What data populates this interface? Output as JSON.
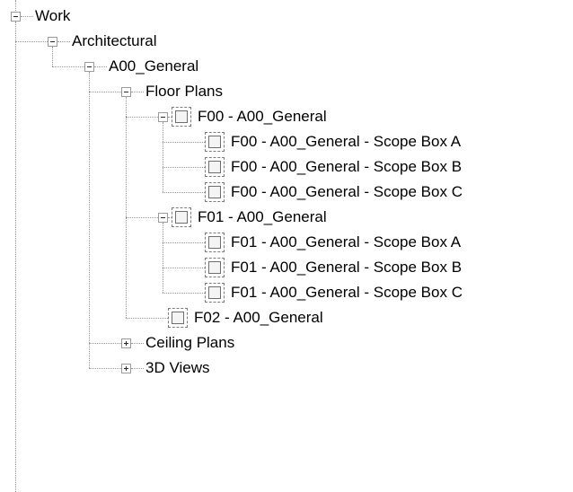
{
  "tree": {
    "label": "Work",
    "expanded": true,
    "icon": null,
    "children": [
      {
        "label": "Architectural",
        "expanded": true,
        "icon": null,
        "children": [
          {
            "label": "A00_General",
            "expanded": true,
            "icon": null,
            "children": [
              {
                "label": "Floor Plans",
                "expanded": true,
                "icon": null,
                "children": [
                  {
                    "label": "F00 - A00_General",
                    "expanded": true,
                    "icon": "view-icon",
                    "children": [
                      {
                        "label": "F00 - A00_General - Scope Box A",
                        "icon": "view-icon",
                        "children": []
                      },
                      {
                        "label": "F00 - A00_General - Scope Box B",
                        "icon": "view-icon",
                        "children": []
                      },
                      {
                        "label": "F00 - A00_General - Scope Box C",
                        "icon": "view-icon",
                        "children": []
                      }
                    ]
                  },
                  {
                    "label": "F01 - A00_General",
                    "expanded": true,
                    "icon": "view-icon",
                    "children": [
                      {
                        "label": "F01 - A00_General - Scope Box A",
                        "icon": "view-icon",
                        "children": []
                      },
                      {
                        "label": "F01 - A00_General - Scope Box B",
                        "icon": "view-icon",
                        "children": []
                      },
                      {
                        "label": "F01 - A00_General - Scope Box C",
                        "icon": "view-icon",
                        "children": []
                      }
                    ]
                  },
                  {
                    "label": "F02 - A00_General",
                    "icon": "view-icon",
                    "children": []
                  }
                ]
              },
              {
                "label": "Ceiling Plans",
                "expanded": false,
                "icon": null,
                "children": []
              },
              {
                "label": "3D Views",
                "expanded": false,
                "icon": null,
                "children": []
              }
            ]
          }
        ]
      }
    ]
  },
  "colors": {
    "background": "#ffffff",
    "text": "#000000",
    "connector": "#9a9a9a"
  }
}
